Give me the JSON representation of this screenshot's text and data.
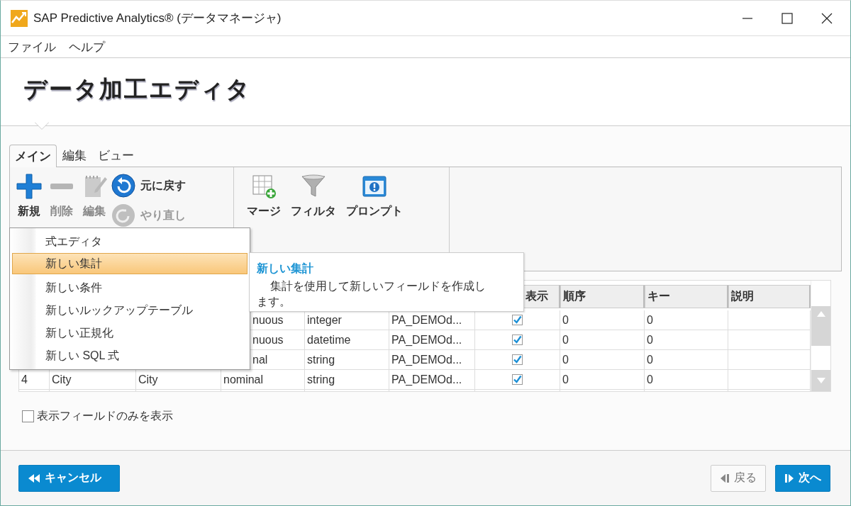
{
  "window": {
    "title": "SAP Predictive Analytics® (データマネージャ)"
  },
  "menu_bar": [
    "ファイル",
    "ヘルプ"
  ],
  "page_title": "データ加工エディタ",
  "tabs": [
    {
      "label": "メイン",
      "selected": true
    },
    {
      "label": "編集",
      "selected": false
    },
    {
      "label": "ビュー",
      "selected": false
    }
  ],
  "ribbon": {
    "groups": [
      {
        "buttons": [
          {
            "kind": "add",
            "label": "新規",
            "disabled": false
          },
          {
            "kind": "remove",
            "label": "削除",
            "disabled": true
          },
          {
            "kind": "edit",
            "label": "編集",
            "disabled": true
          }
        ],
        "side_buttons": [
          {
            "kind": "undo",
            "label": "元に戻す",
            "disabled": false
          },
          {
            "kind": "redo",
            "label": "やり直し",
            "disabled": true
          }
        ]
      },
      {
        "buttons": [
          {
            "kind": "merge",
            "label": "マージ",
            "disabled": false
          },
          {
            "kind": "filter",
            "label": "フィルタ",
            "disabled": false
          },
          {
            "kind": "prompt",
            "label": "プロンプト",
            "disabled": false
          }
        ]
      }
    ]
  },
  "table": {
    "columns": [
      "表示",
      "順序",
      "キー",
      "説明"
    ],
    "rows": [
      {
        "column_4": "nuous",
        "column_5": "integer",
        "column_6": "PA_DEMOd...",
        "column_7": true,
        "column_8": "0",
        "column_9": "0"
      },
      {
        "column_4": "nuous",
        "column_5": "datetime",
        "column_6": "PA_DEMOd...",
        "column_7": true,
        "column_8": "0",
        "column_9": "0"
      },
      {
        "column_4": "nal",
        "column_5": "string",
        "column_6": "PA_DEMOd...",
        "column_7": true,
        "column_8": "0",
        "column_9": "0"
      },
      {
        "column_1": "4",
        "column_2": "City",
        "column_3": "City",
        "column_4": "nominal",
        "column_5": "string",
        "column_6": "PA_DEMOd...",
        "column_7": true,
        "column_8": "0",
        "column_9": "0"
      }
    ]
  },
  "dropdown_menu": {
    "items": [
      {
        "label": "式エディタ",
        "selected": false
      },
      {
        "label": "新しい集計",
        "selected": true
      },
      {
        "label": "新しい条件",
        "selected": false
      },
      {
        "label": "新しいルックアップテーブル",
        "selected": false
      },
      {
        "label": "新しい正規化",
        "selected": false
      },
      {
        "label": "新しい SQL 式",
        "selected": false
      }
    ]
  },
  "tooltip": {
    "title": "新しい集計",
    "text": "集計を使用して新しいフィールドを作成します。"
  },
  "show_visible_only": {
    "label": "表示フィールドのみを表示",
    "checked": false
  },
  "footer": {
    "cancel": "キャンセル",
    "back": {
      "label": "戻る",
      "disabled": true
    },
    "next": "次へ"
  }
}
